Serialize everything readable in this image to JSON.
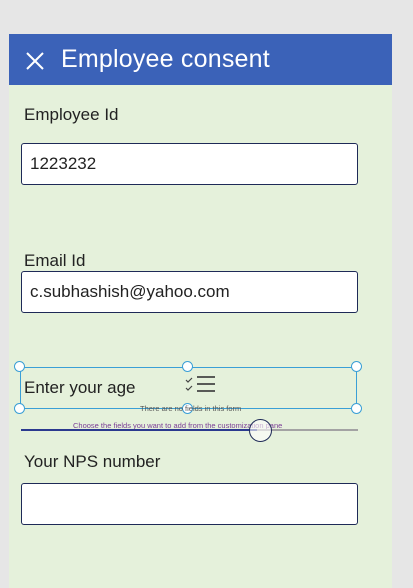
{
  "header": {
    "title": "Employee consent"
  },
  "fields": {
    "employee_id": {
      "label": "Employee Id",
      "value": "1223232"
    },
    "email": {
      "label": "Email Id",
      "value": "c.subhashish@yahoo.com"
    },
    "age": {
      "label": "Enter your age"
    },
    "nps": {
      "label": "Your NPS number",
      "value": ""
    }
  },
  "hints": {
    "line1": "There are no fields in this form",
    "line2": "Choose the fields you want to add from the customization pane"
  },
  "icons": {
    "close": "close-icon",
    "fields": "checklist-icon"
  },
  "colors": {
    "header": "#3b62b8",
    "form_bg": "#e5f1db",
    "selection": "#3a9fd6"
  }
}
